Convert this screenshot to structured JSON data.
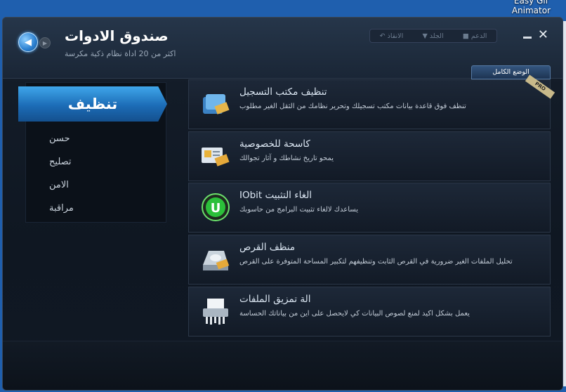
{
  "desktop": {
    "app_line1": "Easy Gif",
    "app_line2": "Animator"
  },
  "header": {
    "title": "صندوق الادوات",
    "subtitle": "اكثر من 20 اداة نظام ذكية مكرسة",
    "links": [
      "الدعم",
      "الجلد",
      "الانقاذ"
    ],
    "mode_label": "الوضع الكامل"
  },
  "sidebar": {
    "active": "تنظيف",
    "items": [
      "حسن",
      "تصليح",
      "الامن",
      "مراقبة"
    ]
  },
  "tools": [
    {
      "title": "تنظيف مكتب التسجيل",
      "desc": "تنظف فوق قاعدة بيانات مكتب تسجيلك وتحرير نظامك من الثقل الغير مطلوب",
      "icon": "registry-icon",
      "badge": "PRO"
    },
    {
      "title": "كاسحة للخصوصية",
      "desc": "يمحو تاريخ نشاطك و آثار تجوالك",
      "icon": "privacy-icon"
    },
    {
      "title": "IObit الغاء التثبيت",
      "desc": "يساعدك لالغاء تثبيت البرامج من حاسوبك",
      "icon": "uninstaller-icon"
    },
    {
      "title": "منظف القرص",
      "desc": "تحليل الملفات الغير ضرورية في القرص الثابت وتنظيفهم لتكبير المساحة المتوفرة على القرص",
      "icon": "disk-cleaner-icon"
    },
    {
      "title": "الة تمزيق الملفات",
      "desc": "يعمل بشكل اكيد لمنع لصوص البيانات كي لايحصل على اين من بياناتك الحساسة",
      "icon": "file-shredder-icon"
    }
  ],
  "colors": {
    "accent": "#2a86d6",
    "panel_bg": "#172130",
    "window_bg": "#121a26"
  }
}
